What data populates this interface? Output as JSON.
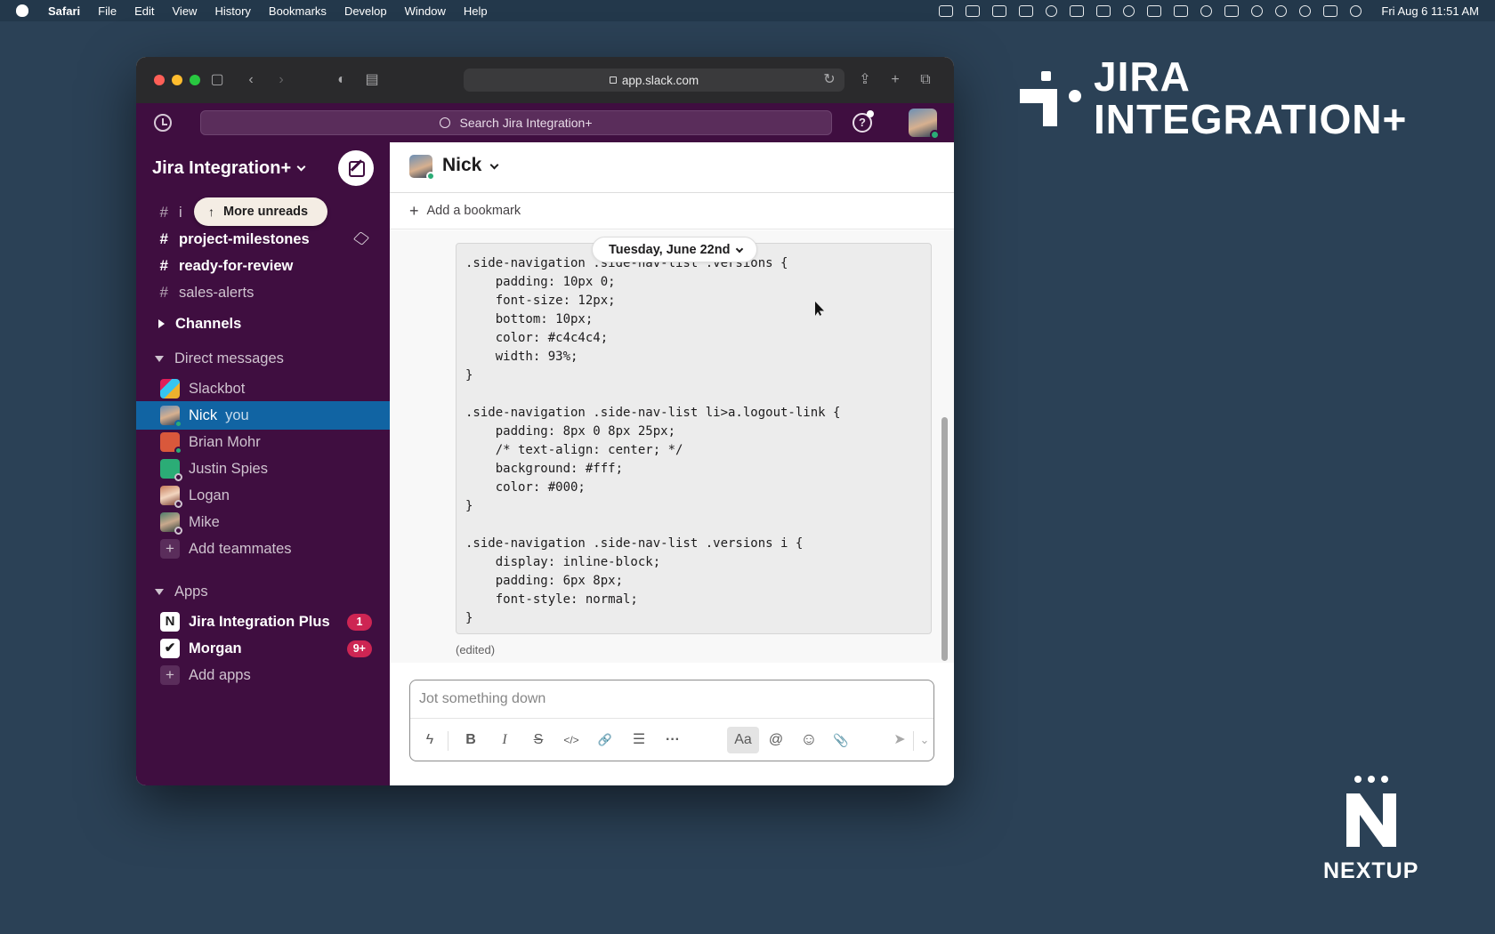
{
  "menubar": {
    "app": "Safari",
    "items": [
      "File",
      "Edit",
      "View",
      "History",
      "Bookmarks",
      "Develop",
      "Window",
      "Help"
    ],
    "clock": "Fri Aug 6  11:51 AM"
  },
  "browser": {
    "url": "app.slack.com"
  },
  "slack": {
    "search_placeholder": "Search Jira Integration+",
    "help_label": "?",
    "workspace": "Jira Integration+",
    "more_unreads": "More unreads",
    "channels": [
      {
        "name": "project-milestones",
        "bold": true
      },
      {
        "name": "ready-for-review",
        "bold": true
      },
      {
        "name": "sales-alerts",
        "bold": false
      }
    ],
    "channels_hidden_first": "i",
    "sections": {
      "channels": "Channels",
      "direct_messages": "Direct messages",
      "apps": "Apps"
    },
    "dms": [
      {
        "name": "Slackbot"
      },
      {
        "name": "Nick",
        "you": "you"
      },
      {
        "name": "Brian Mohr"
      },
      {
        "name": "Justin Spies"
      },
      {
        "name": "Logan"
      },
      {
        "name": "Mike"
      }
    ],
    "add_teammates": "Add teammates",
    "apps": [
      {
        "name": "Jira Integration Plus",
        "badge": "1",
        "tile": "N"
      },
      {
        "name": "Morgan",
        "badge": "9+",
        "tile": "✔"
      }
    ],
    "add_apps": "Add apps",
    "channel_header": {
      "name": "Nick",
      "bookmark": "Add a bookmark"
    },
    "date_divider": "Tuesday, June 22nd",
    "code_lines": [
      ".side-navigation .side-nav-list .versions {",
      "    padding: 10px 0;",
      "    font-size: 12px;",
      "    bottom: 10px;",
      "    color: #c4c4c4;",
      "    width: 93%;",
      "}",
      "",
      ".side-navigation .side-nav-list li>a.logout-link {",
      "    padding: 8px 0 8px 25px;",
      "    /* text-align: center; */",
      "    background: #fff;",
      "    color: #000;",
      "}",
      "",
      ".side-navigation .side-nav-list .versions i {",
      "    display: inline-block;",
      "    padding: 6px 8px;",
      "    font-style: normal;",
      "}"
    ],
    "edited_label": "(edited)",
    "composer_placeholder": "Jot something down",
    "format_buttons": {
      "bold": "B",
      "italic": "I",
      "strike": "S",
      "code": "</>",
      "link": "🔗",
      "list": "☰",
      "more": "···",
      "aa": "Aa",
      "mention": "@",
      "emoji": "☺",
      "attach": "📎",
      "send": "➤",
      "send_options": "⌄"
    }
  },
  "branding": {
    "jira_line1": "JIRA",
    "jira_line2": "INTEGRATION+",
    "nextup": "NEXTUP"
  },
  "colors": {
    "desktop": "#2b4156",
    "slack_aubergine": "#3f0e40",
    "selected": "#1164a3",
    "badge": "#cd2553",
    "online": "#2bac76"
  }
}
